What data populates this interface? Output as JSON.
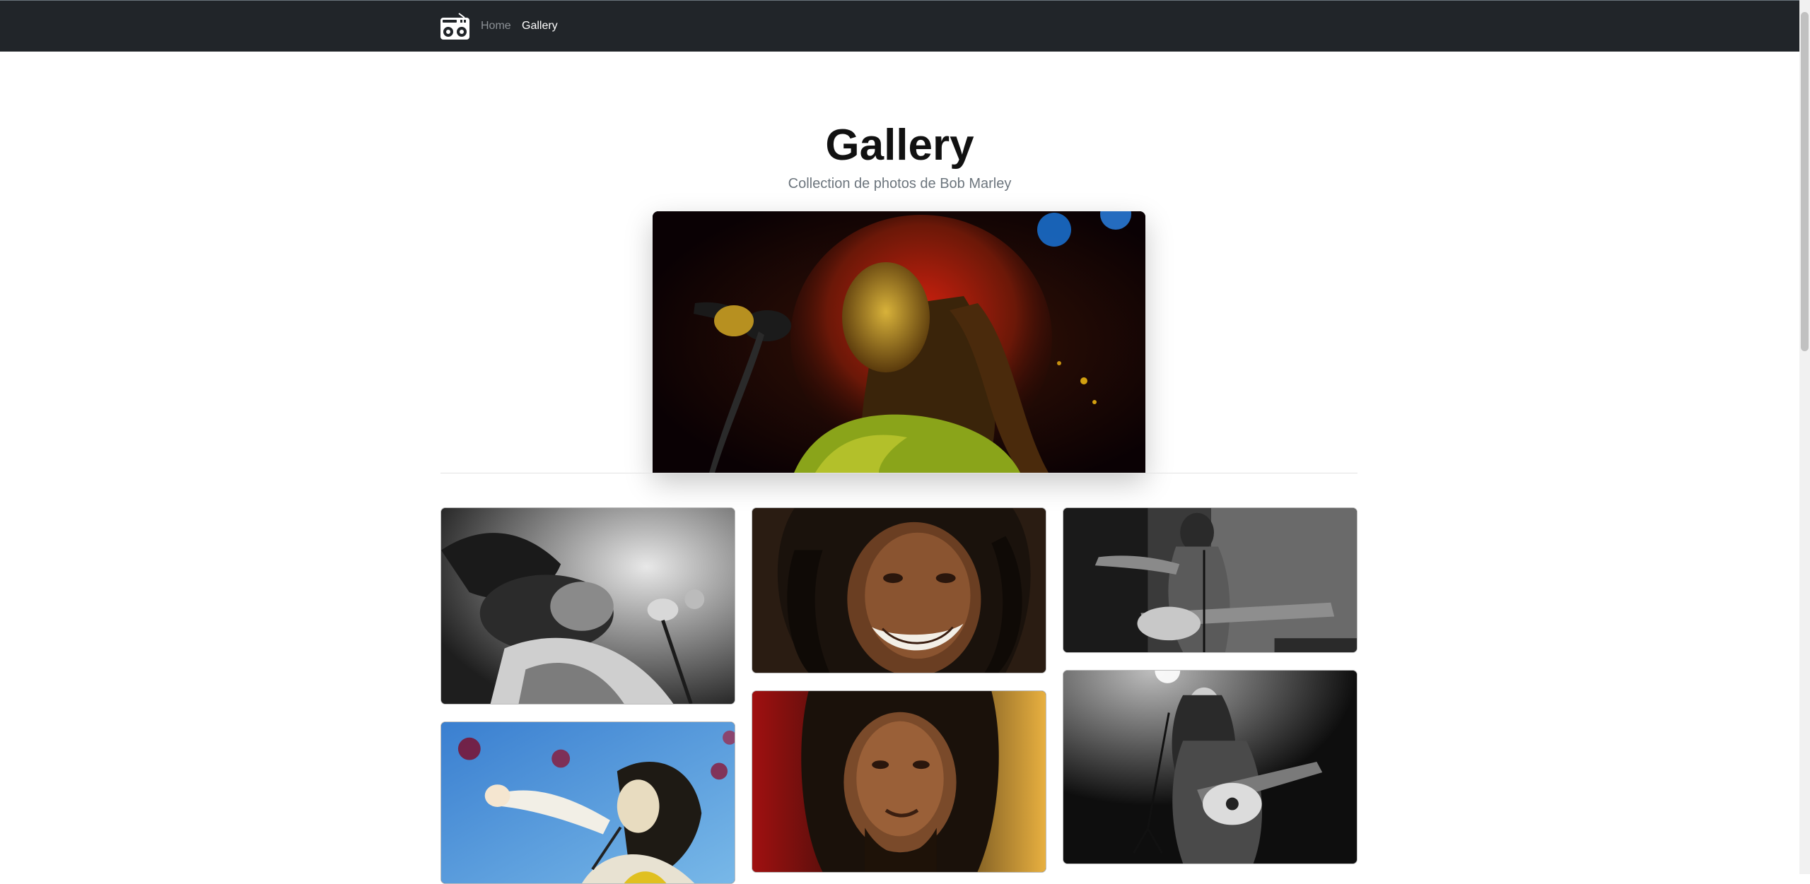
{
  "navbar": {
    "brand_icon": "boombox-icon",
    "links": [
      {
        "label": "Home",
        "active": false
      },
      {
        "label": "Gallery",
        "active": true
      }
    ],
    "background": "#212529"
  },
  "header": {
    "title": "Gallery",
    "subtitle": "Collection de photos de Bob Marley"
  },
  "hero": {
    "alt": "Bob Marley singing into a microphone on stage",
    "tone": "color"
  },
  "gallery": {
    "photos": [
      {
        "alt": "Bob Marley singing, black and white",
        "tone": "bw"
      },
      {
        "alt": "Bob Marley watercolor illustration with microphone",
        "tone": "watercolor"
      },
      {
        "alt": "Bob Marley smiling portrait",
        "tone": "color"
      },
      {
        "alt": "Bob Marley close-up portrait",
        "tone": "color"
      },
      {
        "alt": "Bob Marley pointing with guitar on stage, black and white",
        "tone": "bw"
      },
      {
        "alt": "Bob Marley playing guitar and singing, black and white",
        "tone": "bw"
      }
    ]
  },
  "colors": {
    "text_dark": "#111111",
    "text_muted": "#6c757d",
    "nav_inactive": "#8c9196",
    "nav_active": "#ffffff"
  }
}
